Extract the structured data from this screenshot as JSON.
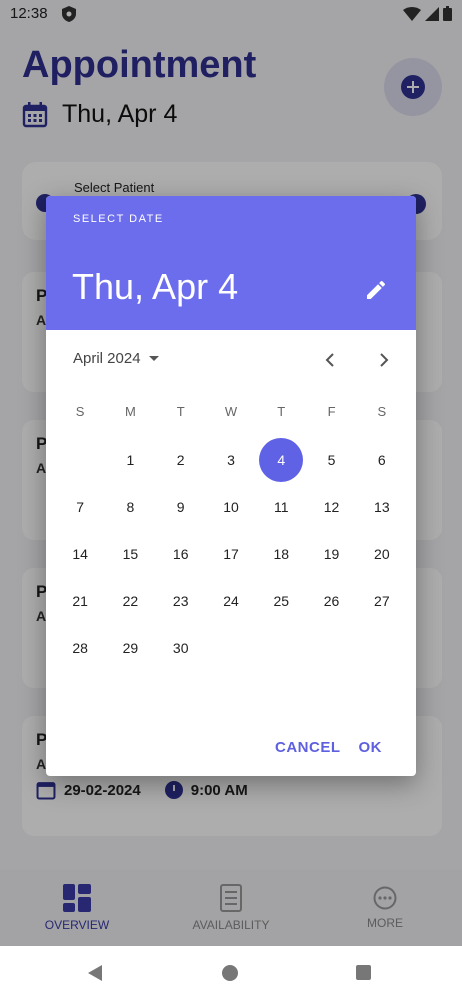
{
  "status_bar": {
    "time": "12:38"
  },
  "app": {
    "title": "Appointment",
    "date": "Thu, Apr 4",
    "select_patient_label": "Select Patient",
    "partial_cards": [
      {
        "line1": "P",
        "line2": "A"
      },
      {
        "line1": "P",
        "line2": "A"
      },
      {
        "line1": "P",
        "line2": "A"
      },
      {
        "line1": "P",
        "line2": "A",
        "date": "29-02-2024",
        "time": "9:00 AM"
      }
    ],
    "bottom_nav": [
      {
        "label": "OVERVIEW",
        "active": true
      },
      {
        "label": "AVAILABILITY",
        "active": false
      },
      {
        "label": "MORE",
        "active": false
      }
    ]
  },
  "date_picker": {
    "header_label": "SELECT DATE",
    "header_date": "Thu, Apr 4",
    "month_label": "April 2024",
    "weekdays": [
      "S",
      "M",
      "T",
      "W",
      "T",
      "F",
      "S"
    ],
    "weeks": [
      [
        "",
        "1",
        "2",
        "3",
        "4",
        "5",
        "6"
      ],
      [
        "7",
        "8",
        "9",
        "10",
        "11",
        "12",
        "13"
      ],
      [
        "14",
        "15",
        "16",
        "17",
        "18",
        "19",
        "20"
      ],
      [
        "21",
        "22",
        "23",
        "24",
        "25",
        "26",
        "27"
      ],
      [
        "28",
        "29",
        "30",
        "",
        "",
        "",
        ""
      ]
    ],
    "selected_day": "4",
    "cancel_label": "CANCEL",
    "ok_label": "OK"
  },
  "colors": {
    "accent": "#6c6ded",
    "selected": "#6062e6",
    "brand_dark": "#2e2f8f"
  }
}
